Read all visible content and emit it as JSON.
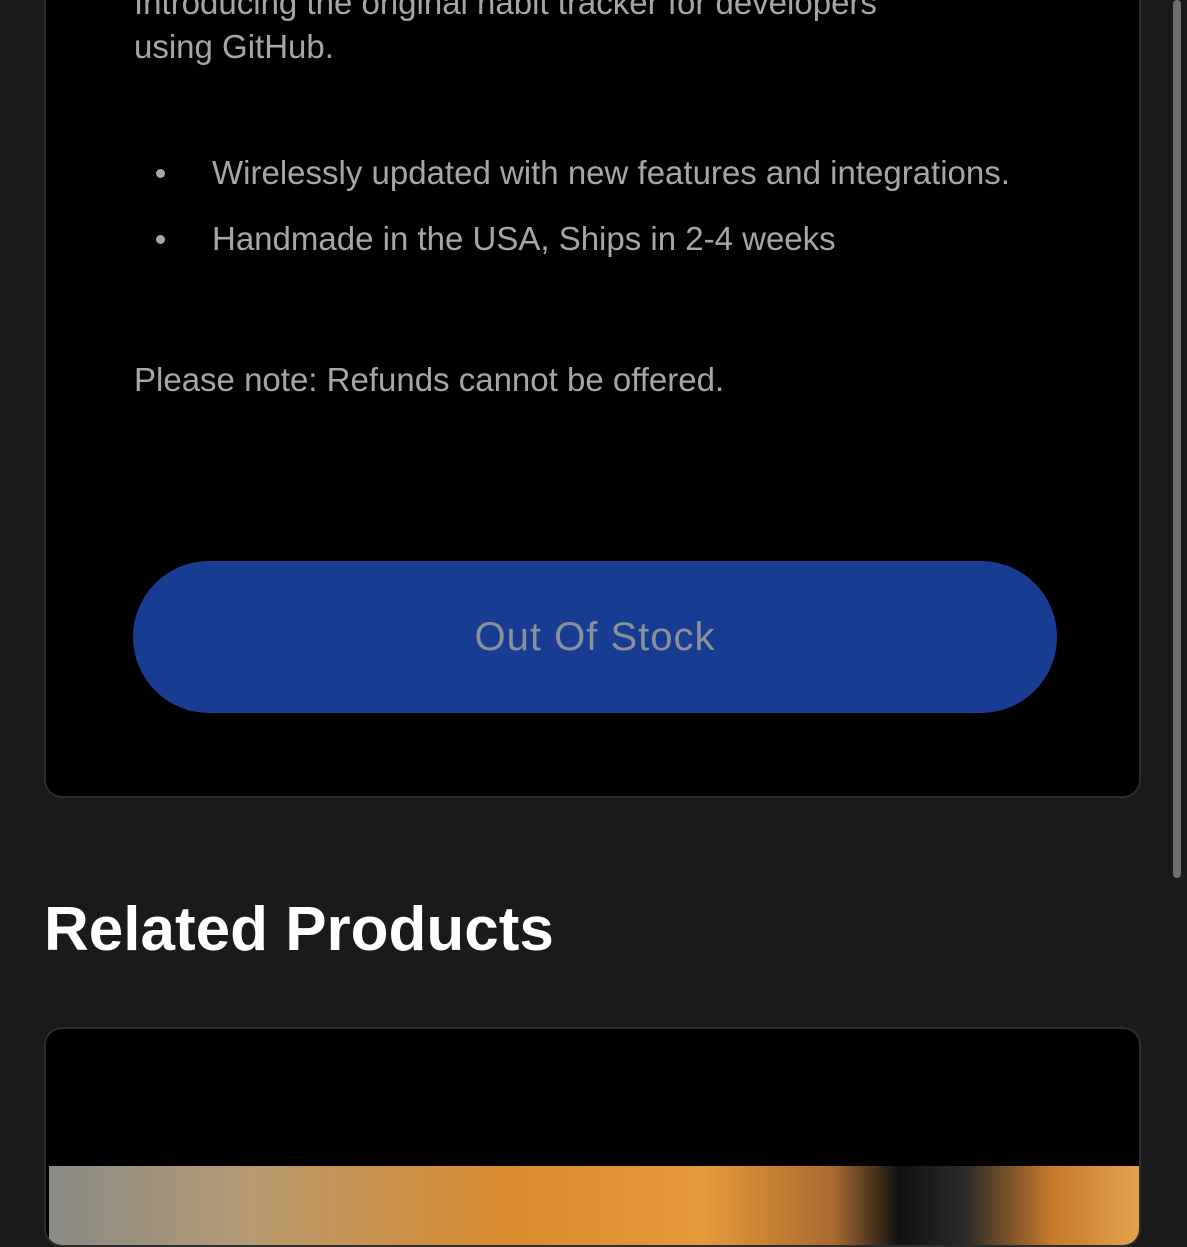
{
  "product": {
    "description_top": "Introducing the original habit tracker for developers",
    "description_line2": "using GitHub.",
    "features": [
      "Wirelessly updated with new features and integrations.",
      "Handmade in the USA, Ships in 2-4 weeks"
    ],
    "note": "Please note: Refunds cannot be offered.",
    "button_label": "Out Of Stock"
  },
  "related": {
    "title": "Related Products"
  },
  "colors": {
    "page_background": "#1a1a1a",
    "card_background": "#000000",
    "button_background": "#183c92",
    "button_text": "#8a8f9c",
    "body_text": "#a6a6a6",
    "heading_text": "#ffffff"
  }
}
